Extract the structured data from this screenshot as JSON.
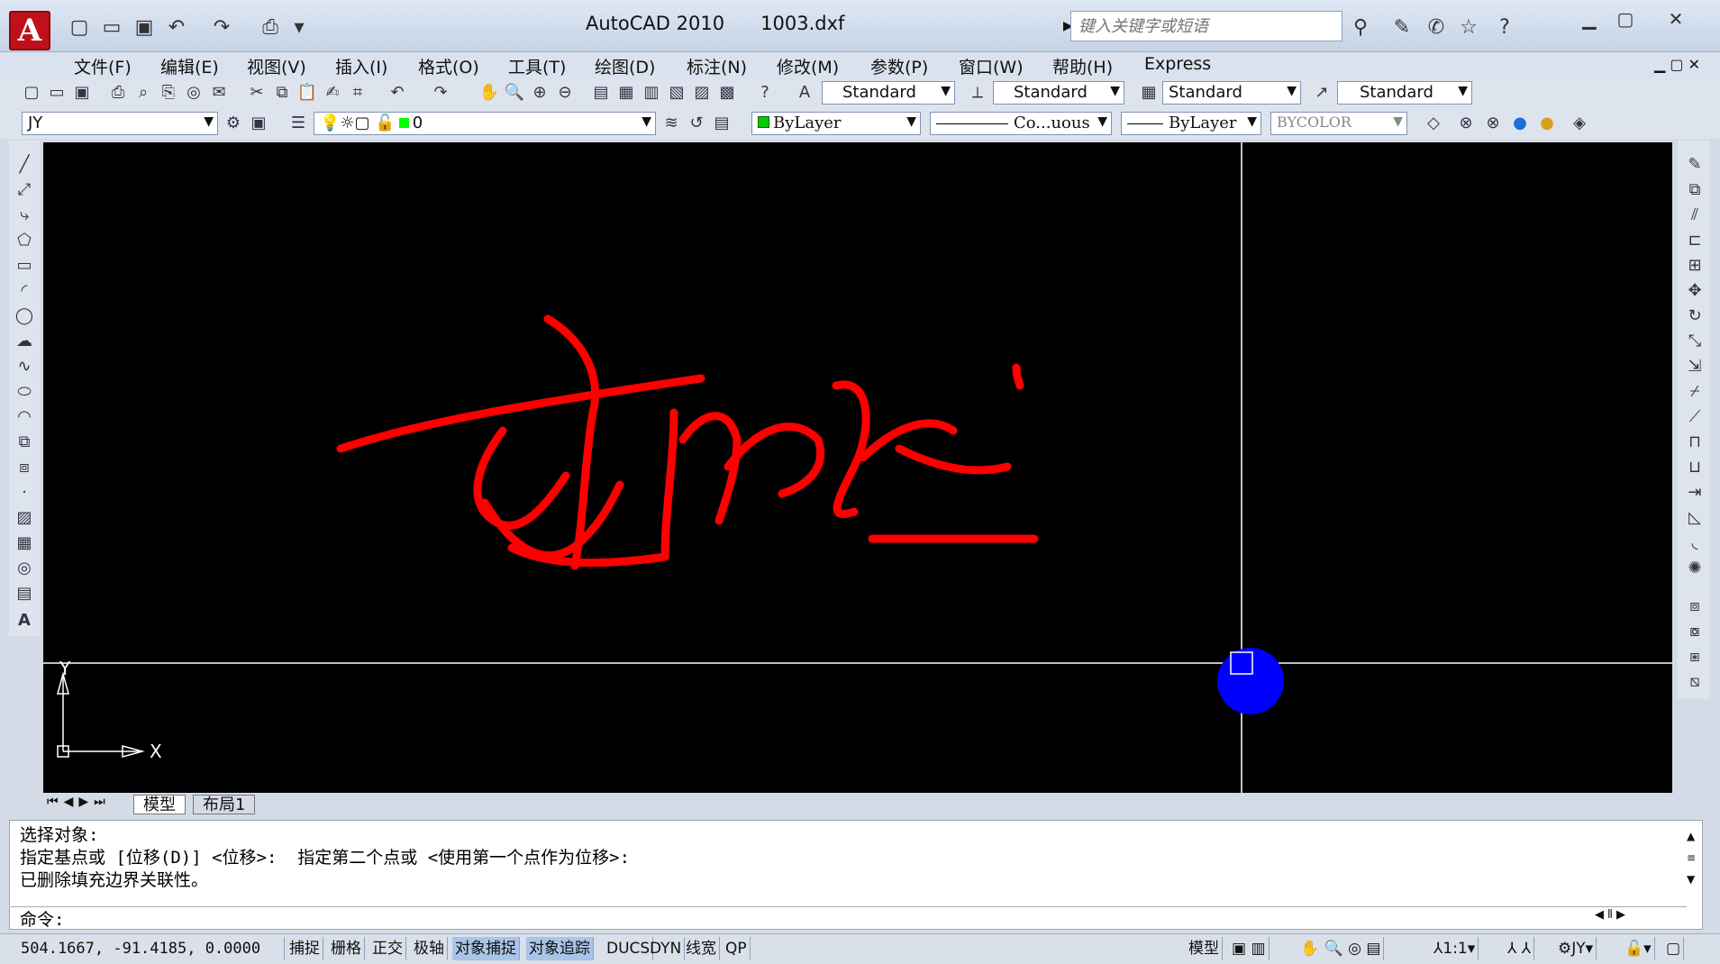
{
  "window": {
    "app": "AutoCAD 2010",
    "file": "1003.dxf",
    "minimize_icon": "minimize-icon",
    "maximize_icon": "maximize-icon",
    "close_icon": "close-icon"
  },
  "search": {
    "placeholder": "键入关键字或短语"
  },
  "menu": [
    "文件(F)",
    "编辑(E)",
    "视图(V)",
    "插入(I)",
    "格式(O)",
    "工具(T)",
    "绘图(D)",
    "标注(N)",
    "修改(M)",
    "参数(P)",
    "窗口(W)",
    "帮助(H)",
    "Express"
  ],
  "styles": {
    "text": "Standard",
    "dim": "Standard",
    "table": "Standard",
    "multileader": "Standard"
  },
  "properties": {
    "workspace": "JY",
    "layer": "0",
    "color": "ByLayer",
    "linetype": "Co...uous",
    "lineweight": "ByLayer",
    "plotstyle": "BYCOLOR"
  },
  "ucs": {
    "y": "Y",
    "x": "X"
  },
  "tabs": [
    "模型",
    "布局1"
  ],
  "command": {
    "lines": [
      "选择对象:",
      "指定基点或 [位移(D)] <位移>:  指定第二个点或 <使用第一个点作为位移>:",
      "已删除填充边界关联性。"
    ],
    "prompt": "命令:"
  },
  "status": {
    "coords": "504.1667, -91.4185, 0.0000",
    "toggles": [
      "捕捉",
      "栅格",
      "正交",
      "极轴",
      "对象捕捉",
      "对象追踪",
      "DUCS",
      "DYN",
      "线宽",
      "QP"
    ],
    "active_toggles": [
      "对象捕捉",
      "对象追踪"
    ],
    "model": "模型",
    "scale": "1:1",
    "workspace": "JY"
  },
  "colors": {
    "signature": "#ff0000",
    "cursor_marker": "#0000ff",
    "canvas": "#000000"
  }
}
